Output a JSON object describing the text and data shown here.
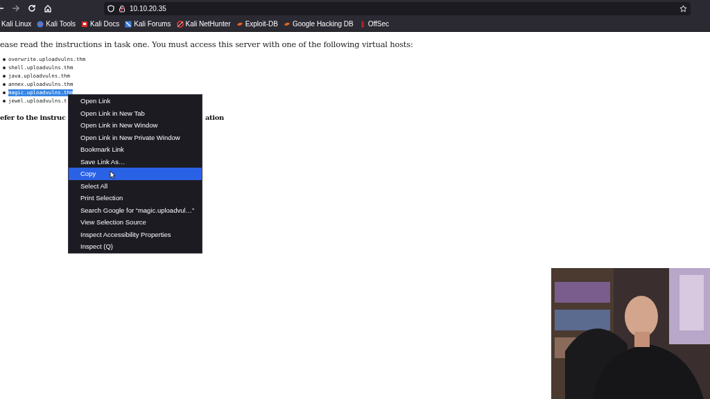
{
  "toolbar": {
    "url": "10.10.20.35"
  },
  "bookmarks": [
    {
      "label": "Kali Linux"
    },
    {
      "label": "Kali Tools"
    },
    {
      "label": "Kali Docs"
    },
    {
      "label": "Kali Forums"
    },
    {
      "label": "Kali NetHunter"
    },
    {
      "label": "Exploit-DB"
    },
    {
      "label": "Google Hacking DB"
    },
    {
      "label": "OffSec"
    }
  ],
  "page": {
    "intro": "ease read the instructions in task one. You must access this server with one of the following virtual hosts:",
    "hosts": [
      {
        "text": "overwrite.uploadvulns.thm",
        "selected": false
      },
      {
        "text": "shell.uploadvulns.thm",
        "selected": false
      },
      {
        "text": "java.uploadvulns.thm",
        "selected": false
      },
      {
        "text": "annex.uploadvulns.thm",
        "selected": false
      },
      {
        "text": "magic.uploadvulns.thm",
        "selected": true
      },
      {
        "text": "jewel.uploadvulns.t",
        "selected": false
      }
    ],
    "heading_parts": [
      "efer to the instruc",
      "ation"
    ]
  },
  "context_menu": [
    {
      "label": "Open Link",
      "selected": false
    },
    {
      "label": "Open Link in New Tab",
      "selected": false
    },
    {
      "label": "Open Link in New Window",
      "selected": false
    },
    {
      "label": "Open Link in New Private Window",
      "selected": false
    },
    {
      "label": "Bookmark Link",
      "selected": false
    },
    {
      "label": "Save Link As…",
      "selected": false
    },
    {
      "label": "Copy",
      "selected": true
    },
    {
      "label": "Select All",
      "selected": false
    },
    {
      "label": "Print Selection",
      "selected": false
    },
    {
      "label": "Search Google for “magic.uploadvul…”",
      "selected": false
    },
    {
      "label": "View Selection Source",
      "selected": false
    },
    {
      "label": "Inspect Accessibility Properties",
      "selected": false
    },
    {
      "label": "Inspect (Q)",
      "selected": false
    }
  ]
}
